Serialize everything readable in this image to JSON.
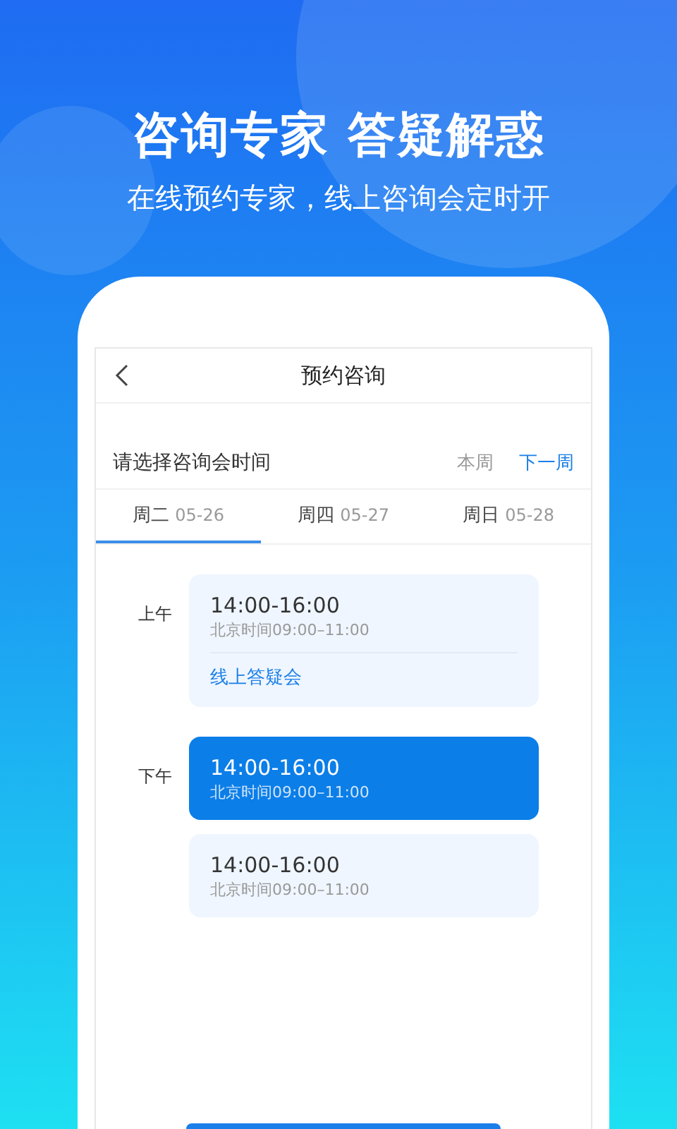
{
  "headline": "咨询专家 答疑解惑",
  "subtitle": "在线预约专家，线上咨询会定时开",
  "screen": {
    "title": "预约咨询",
    "prompt": "请选择咨询会时间",
    "week_options": [
      {
        "label": "本周",
        "selected": false
      },
      {
        "label": "下一周",
        "selected": true
      }
    ],
    "days": [
      {
        "weekday": "周二",
        "date": "05-26",
        "selected": true
      },
      {
        "weekday": "周四",
        "date": "05-27",
        "selected": false
      },
      {
        "weekday": "周日",
        "date": "05-28",
        "selected": false
      }
    ],
    "periods": [
      {
        "label": "上午",
        "slots": [
          {
            "time": "14:00-16:00",
            "local_time": "北京时间09:00–11:00",
            "tag": "线上答疑会",
            "selected": false
          }
        ]
      },
      {
        "label": "下午",
        "slots": [
          {
            "time": "14:00-16:00",
            "local_time": "北京时间09:00–11:00",
            "selected": true
          },
          {
            "time": "14:00-16:00",
            "local_time": "北京时间09:00–11:00",
            "selected": false
          }
        ]
      }
    ]
  }
}
